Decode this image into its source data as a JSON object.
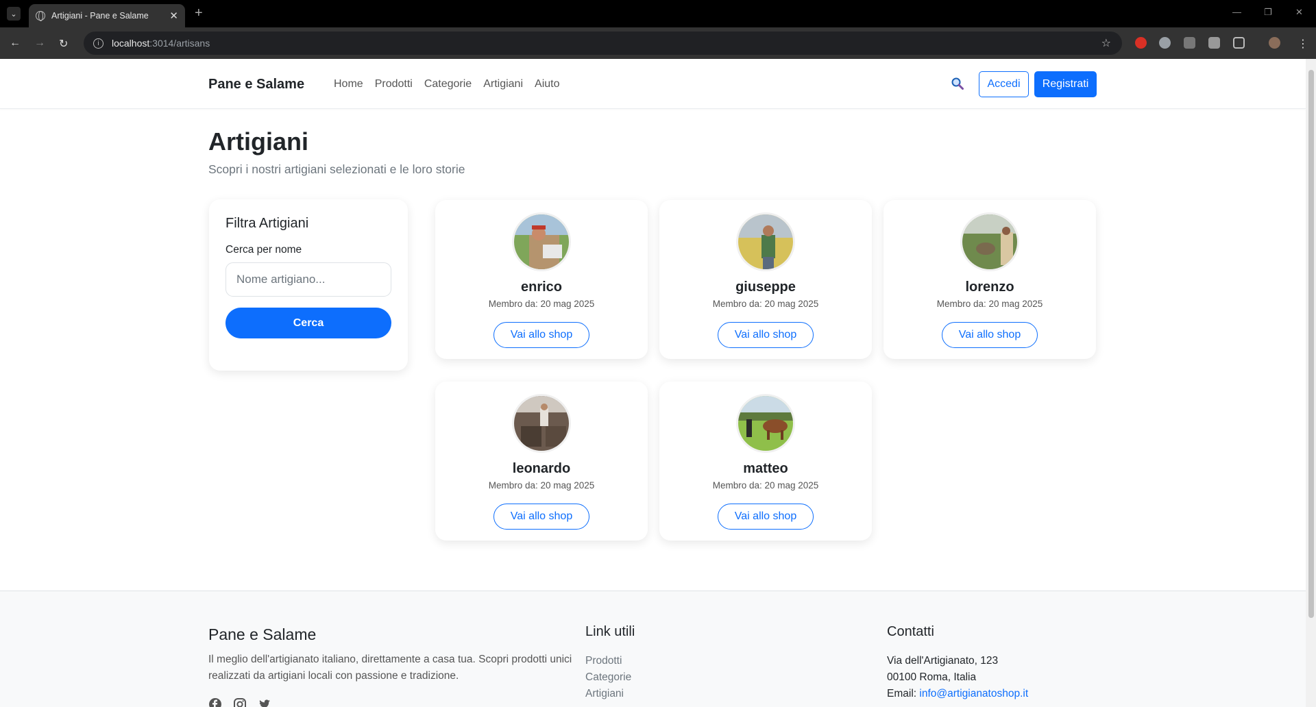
{
  "browser": {
    "tab_title": "Artigiani - Pane e Salame",
    "url_host": "localhost",
    "url_path": ":3014/artisans"
  },
  "nav": {
    "brand": "Pane e Salame",
    "links": [
      "Home",
      "Prodotti",
      "Categorie",
      "Artigiani",
      "Aiuto"
    ],
    "login_label": "Accedi",
    "register_label": "Registrati"
  },
  "header": {
    "title": "Artigiani",
    "subtitle": "Scopri i nostri artigiani selezionati e le loro storie"
  },
  "filter": {
    "title": "Filtra Artigiani",
    "search_label": "Cerca per nome",
    "search_placeholder": "Nome artigiano...",
    "search_button": "Cerca"
  },
  "artisans": [
    {
      "name": "enrico",
      "since": "Membro da: 20 mag 2025",
      "cta": "Vai allo shop"
    },
    {
      "name": "giuseppe",
      "since": "Membro da: 20 mag 2025",
      "cta": "Vai allo shop"
    },
    {
      "name": "lorenzo",
      "since": "Membro da: 20 mag 2025",
      "cta": "Vai allo shop"
    },
    {
      "name": "leonardo",
      "since": "Membro da: 20 mag 2025",
      "cta": "Vai allo shop"
    },
    {
      "name": "matteo",
      "since": "Membro da: 20 mag 2025",
      "cta": "Vai allo shop"
    }
  ],
  "footer": {
    "brand": "Pane e Salame",
    "description": "Il meglio dell'artigianato italiano, direttamente a casa tua. Scopri prodotti unici realizzati da artigiani locali con passione e tradizione.",
    "links_title": "Link utili",
    "links": [
      "Prodotti",
      "Categorie",
      "Artigiani"
    ],
    "contact_title": "Contatti",
    "address_line1": "Via dell'Artigianato, 123",
    "address_line2": "00100 Roma, Italia",
    "email_label": "Email: ",
    "email": "info@artigianatoshop.it"
  },
  "colors": {
    "primary": "#0d6efd",
    "text": "#212529",
    "muted": "#6c757d"
  }
}
